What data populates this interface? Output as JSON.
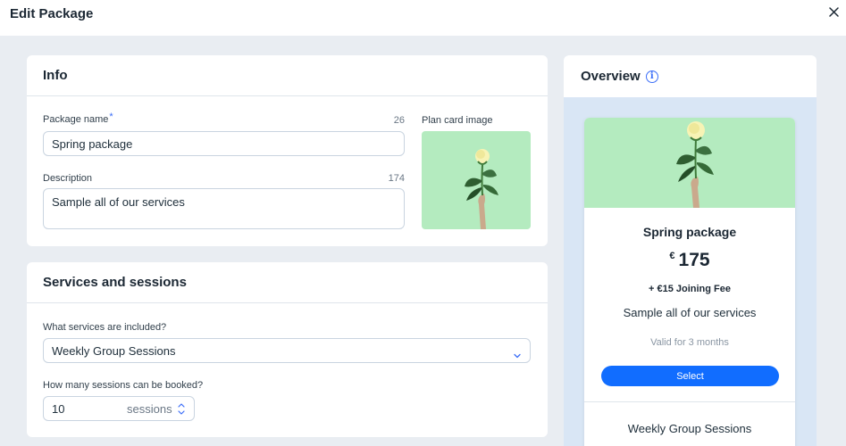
{
  "header": {
    "title": "Edit Package",
    "close_icon": "close-icon"
  },
  "info": {
    "heading": "Info",
    "name_label": "Package name",
    "required_mark": "*",
    "name_count": "26",
    "name_value": "Spring package",
    "description_label": "Description",
    "description_count": "174",
    "description_value": "Sample all of our services",
    "image_label": "Plan card image"
  },
  "services": {
    "heading": "Services and sessions",
    "services_label": "What services are included?",
    "services_value": "Weekly Group Sessions",
    "sessions_label": "How many sessions can be booked?",
    "sessions_value": "10",
    "sessions_unit": "sessions"
  },
  "overview": {
    "heading": "Overview",
    "info_icon": "i",
    "plan_name": "Spring package",
    "currency": "€",
    "price": "175",
    "joining_fee": "+ €15 Joining Fee",
    "description": "Sample all of our services",
    "validity": "Valid for 3 months",
    "select_label": "Select",
    "service_item": "Weekly Group Sessions"
  },
  "colors": {
    "accent": "#116dff",
    "image_background": "#b4ebbf",
    "page_background": "#e9edf2",
    "overview_background": "#d9e6f5"
  }
}
